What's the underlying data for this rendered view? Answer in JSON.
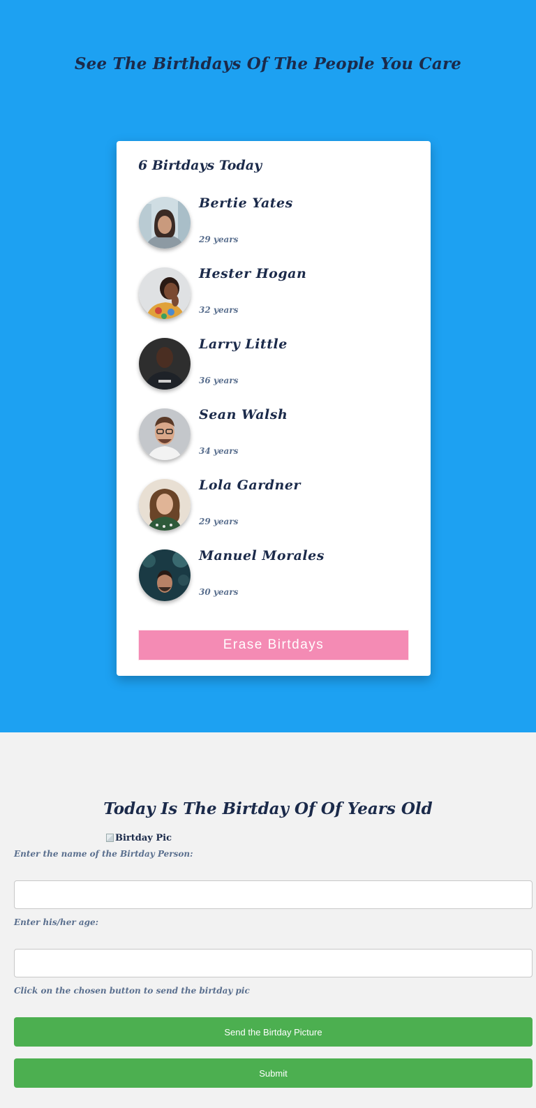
{
  "header": {
    "title": "See The Birthdays Of The People You Care"
  },
  "card": {
    "title": "6 Birtdays Today",
    "people": [
      {
        "name": "Bertie Yates",
        "age": "29 years"
      },
      {
        "name": "Hester Hogan",
        "age": "32 years"
      },
      {
        "name": "Larry Little",
        "age": "36 years"
      },
      {
        "name": "Sean Walsh",
        "age": "34 years"
      },
      {
        "name": "Lola Gardner",
        "age": "29 years"
      },
      {
        "name": "Manuel Morales",
        "age": "30 years"
      }
    ],
    "erase_label": "Erase Birtdays"
  },
  "form": {
    "title": "Today Is The Birtday Of Of Years Old",
    "image_alt": "Birtday Pic",
    "name_label": "Enter the name of the Birtday Person:",
    "age_label": "Enter his/her age:",
    "pic_label": "Click on the chosen button to send the birtday pic",
    "send_pic_label": "Send the Birtday Picture",
    "submit_label": "Submit"
  },
  "colors": {
    "top_background": "#1da1f2",
    "card_background": "#ffffff",
    "erase_button": "#f48bb4",
    "green_button": "#4caf50",
    "title_text": "#1b2a4a"
  }
}
